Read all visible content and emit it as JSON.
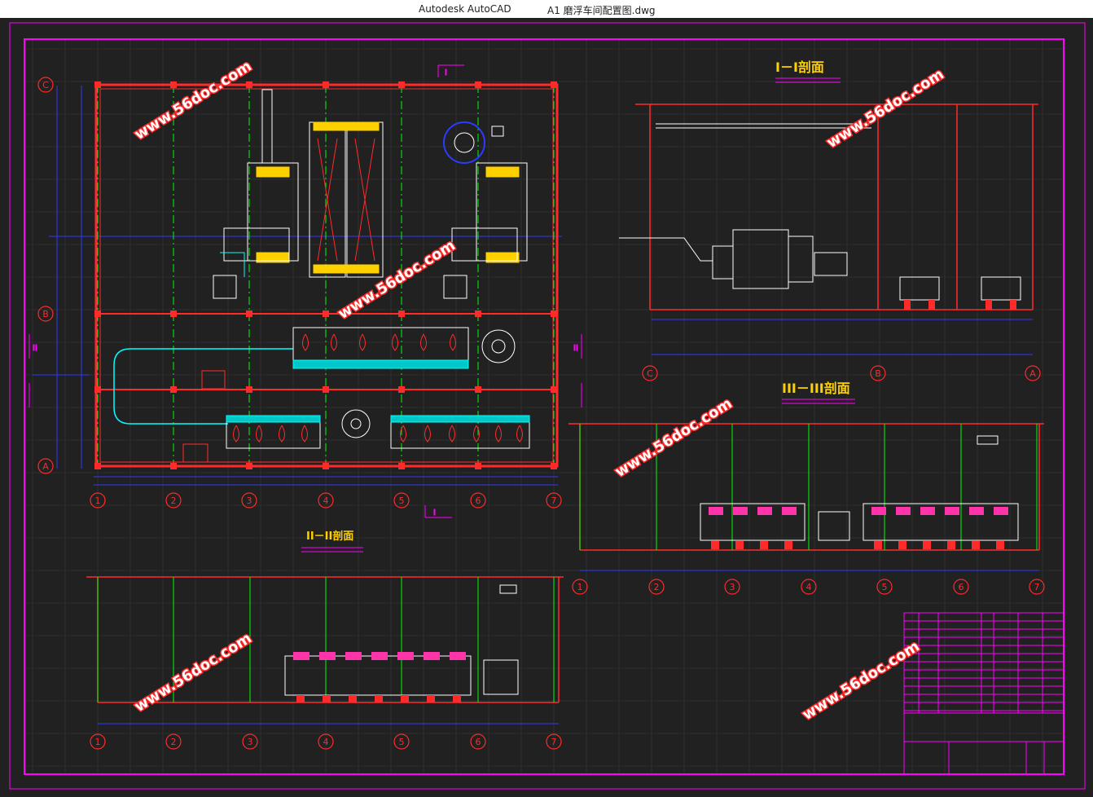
{
  "window": {
    "app_name": "Autodesk AutoCAD",
    "document_title": "A1  磨浮车间配置图.dwg"
  },
  "drawing": {
    "sections": {
      "section_1": "I－I剖面",
      "section_2": "II－II剖面",
      "section_3": "III－III剖面"
    },
    "watermark": "www.56doc.com",
    "column_labels": [
      "1",
      "2",
      "3",
      "4",
      "5",
      "6",
      "7"
    ],
    "row_labels": [
      "A",
      "B",
      "C"
    ],
    "section1_axis_labels": [
      "C",
      "B",
      "A"
    ],
    "section_marks": {
      "i": "I",
      "ii": "II"
    },
    "colors": {
      "background": "#212121",
      "frame": "#ff00ff",
      "wall": "#ff2a2a",
      "grid": "#00ff00",
      "dimension": "#2b3bff",
      "equipment": "#ffffff",
      "label": "#ffff00",
      "cyan": "#00ffff"
    }
  }
}
